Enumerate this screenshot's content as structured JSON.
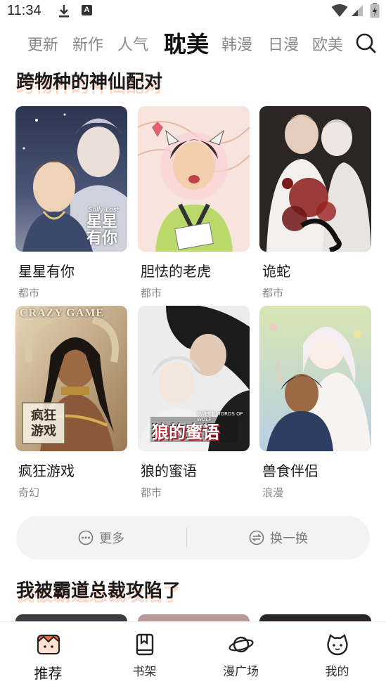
{
  "status_bar": {
    "time": "11:34",
    "icons": [
      "download-icon",
      "a-badge-icon",
      "wifi-icon",
      "signal-icon",
      "battery-icon"
    ]
  },
  "tabs": [
    {
      "label": "更新",
      "active": false
    },
    {
      "label": "新作",
      "active": false
    },
    {
      "label": "人气",
      "active": false
    },
    {
      "label": "耽美",
      "active": true
    },
    {
      "label": "韩漫",
      "active": false
    },
    {
      "label": "日漫",
      "active": false
    },
    {
      "label": "欧美",
      "active": false
    }
  ],
  "section1": {
    "title": "跨物种的神仙配对",
    "cards": [
      {
        "title": "星星有你",
        "genre": "都市",
        "cover_text": "星星有你",
        "cover_subtext": "Sully Lost"
      },
      {
        "title": "胆怯的老虎",
        "genre": "都市"
      },
      {
        "title": "诡蛇",
        "genre": "都市"
      },
      {
        "title": "疯狂游戏",
        "genre": "奇幻",
        "cover_text": "疯狂游戏",
        "cover_top_text": "CRAZY GAME"
      },
      {
        "title": "狼的蜜语",
        "genre": "都市",
        "cover_text": "狼的蜜语",
        "cover_subtext": "SWEET WORDS OF WOLF"
      },
      {
        "title": "兽食伴侣",
        "genre": "浪漫"
      }
    ]
  },
  "actions": {
    "more_label": "更多",
    "refresh_label": "换一换"
  },
  "section2": {
    "title": "我被霸道总裁攻陷了"
  },
  "bottom_nav": [
    {
      "label": "推荐",
      "icon": "recommend-icon",
      "active": true
    },
    {
      "label": "书架",
      "icon": "bookshelf-icon",
      "active": false
    },
    {
      "label": "漫广场",
      "icon": "planet-icon",
      "active": false
    },
    {
      "label": "我的",
      "icon": "cat-face-icon",
      "active": false
    }
  ],
  "colors": {
    "accent": "#ff6a3d",
    "title_shadow": "#ffb08f",
    "muted_text": "#8a8a8a"
  }
}
